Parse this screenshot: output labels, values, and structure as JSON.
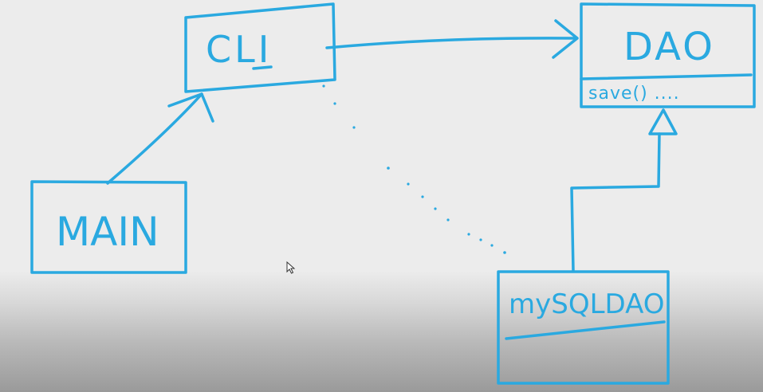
{
  "diagram": {
    "boxes": {
      "cli": {
        "label": "CLI"
      },
      "dao": {
        "label": "DAO",
        "method": "save() ...."
      },
      "main": {
        "label": "MAIN"
      },
      "mysqldao": {
        "label": "mySQLDAO"
      }
    },
    "stroke_color": "#2aa9e0",
    "background_color": "#ececec"
  }
}
